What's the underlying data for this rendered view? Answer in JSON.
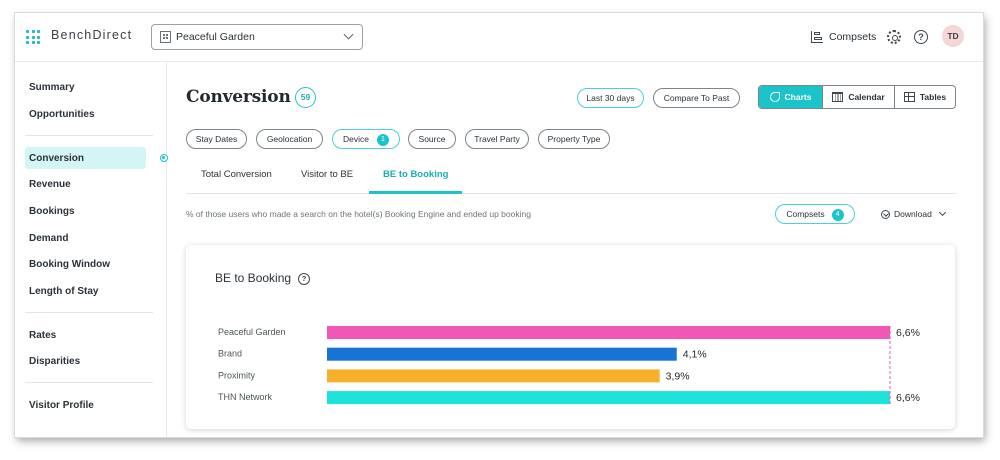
{
  "app": {
    "brand": "BenchDirect",
    "property": "Peaceful Garden"
  },
  "topbar": {
    "compsets_label": "Compsets",
    "avatar_initials": "TD"
  },
  "sidebar": {
    "group1": [
      {
        "label": "Summary"
      },
      {
        "label": "Opportunities"
      }
    ],
    "group2": [
      {
        "label": "Conversion",
        "active": true
      },
      {
        "label": "Revenue"
      },
      {
        "label": "Bookings"
      },
      {
        "label": "Demand"
      },
      {
        "label": "Booking Window"
      },
      {
        "label": "Length of Stay"
      }
    ],
    "group3": [
      {
        "label": "Rates"
      },
      {
        "label": "Disparities"
      }
    ],
    "group4": [
      {
        "label": "Visitor Profile"
      }
    ]
  },
  "header": {
    "title": "Conversion",
    "count": "59",
    "period": "Last 30 days",
    "compare": "Compare To Past",
    "views": {
      "charts": "Charts",
      "calendar": "Calendar",
      "tables": "Tables",
      "active": "charts"
    }
  },
  "filters": [
    {
      "label": "Stay Dates"
    },
    {
      "label": "Geolocation"
    },
    {
      "label": "Device",
      "badge": "1"
    },
    {
      "label": "Source"
    },
    {
      "label": "Travel Party"
    },
    {
      "label": "Property Type"
    }
  ],
  "tabs": [
    {
      "label": "Total Conversion"
    },
    {
      "label": "Visitor to BE"
    },
    {
      "label": "BE to Booking",
      "active": true
    }
  ],
  "description": "% of those users who made a search on the hotel(s) Booking Engine and ended up booking",
  "compsets_button": {
    "label": "Compsets",
    "count": "4"
  },
  "download": {
    "label": "Download"
  },
  "card": {
    "title": "BE to Booking"
  },
  "chart_data": {
    "type": "bar",
    "orientation": "horizontal",
    "title": "BE to Booking",
    "categories": [
      "Peaceful Garden",
      "Brand",
      "Proximity",
      "THN Network"
    ],
    "values": [
      6.6,
      4.1,
      3.9,
      6.6
    ],
    "value_labels": [
      "6,6%",
      "4,1%",
      "3,9%",
      "6,6%"
    ],
    "colors": [
      "#f157b4",
      "#1774d4",
      "#f8b02a",
      "#1ee3da"
    ],
    "reference_line": {
      "value": 6.6,
      "color": "#ee5aa8",
      "style": "dashed"
    },
    "xlim": [
      0,
      6.6
    ],
    "grid": false,
    "legend": "none"
  }
}
